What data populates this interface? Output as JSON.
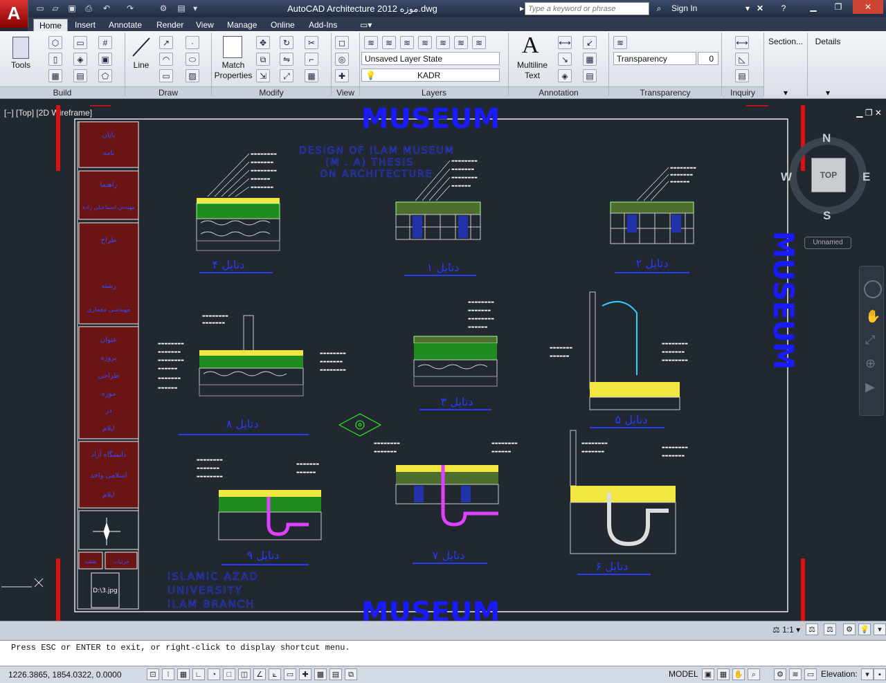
{
  "titlebar": {
    "app_letter": "A",
    "title": "AutoCAD Architecture 2012    موزه.dwg",
    "search_placeholder": "Type a keyword or phrase",
    "sign_in": "Sign In"
  },
  "tabs": [
    "Home",
    "Insert",
    "Annotate",
    "Render",
    "View",
    "Manage",
    "Online",
    "Add-Ins"
  ],
  "active_tab": "Home",
  "ribbon": {
    "tools_label": "Tools",
    "line_label": "Line",
    "match_label_1": "Match",
    "match_label_2": "Properties",
    "layer_state": "Unsaved Layer State",
    "layer_name": "KADR",
    "multiline_1": "Multiline",
    "multiline_2": "Text",
    "transparency_label": "Transparency",
    "transparency_value": "0",
    "section_label": "Section...",
    "details_label": "Details",
    "panels": {
      "build": "Build",
      "draw": "Draw",
      "modify": "Modify",
      "view": "View",
      "layers": "Layers",
      "annotation": "Annotation",
      "transparency": "Transparency",
      "inquiry": "Inquiry"
    }
  },
  "viewport": {
    "label": "[−] [Top] [2D Wireframe]",
    "viewcube": {
      "top": "TOP",
      "n": "N",
      "s": "S",
      "e": "E",
      "w": "W",
      "unnamed": "Unnamed"
    }
  },
  "drawing": {
    "title_top": "MUSEUM",
    "title_bottom": "MUSEUM",
    "title_side": "MUSEUM",
    "design_lines": [
      "DESIGN OF ILAM MUSEUM",
      "(M . A) THESIS",
      "ON ARCHITECTURE"
    ],
    "univ_lines": [
      "ISLAMIC AZAD",
      "UNIVERSITY",
      "ILAM BRANCH"
    ],
    "sidebar_cells": [
      [
        "پایان",
        "نامه"
      ],
      [
        "راهنما",
        "مهندس اسماعیلی زاده"
      ],
      [
        "طراح",
        "رشته",
        "مهندسی معماری"
      ],
      [
        "عنوان",
        "پروژه",
        "طراحی",
        "موزه",
        "در",
        "ایلام"
      ],
      [
        "دانشگاه آزاد",
        "اسلامی واحد",
        "ایلام"
      ]
    ],
    "sidebar_bottom": [
      "نقشه",
      "جزئیات"
    ],
    "image_label": "D:\\3.jpg",
    "details": [
      {
        "label": "دتایل ۴"
      },
      {
        "label": "دتایل ۱"
      },
      {
        "label": "دتایل ۲"
      },
      {
        "label": "دتایل ۸"
      },
      {
        "label": "دتایل ۳"
      },
      {
        "label": "دتایل ۵"
      },
      {
        "label": "دتایل ۹"
      },
      {
        "label": "دتایل ۷"
      },
      {
        "label": "دتایل ۶"
      }
    ]
  },
  "command": {
    "text": "Press ESC or ENTER to exit, or right-click to display shortcut menu."
  },
  "status": {
    "coords": "1226.3865, 1854.0322, 0.0000",
    "model": "MODEL",
    "scale": "1:1",
    "elevation": "Elevation:"
  },
  "colors": {
    "drawing_bg": "#212830",
    "title_blue": "#1a1aff",
    "frame_red": "#e01010"
  }
}
